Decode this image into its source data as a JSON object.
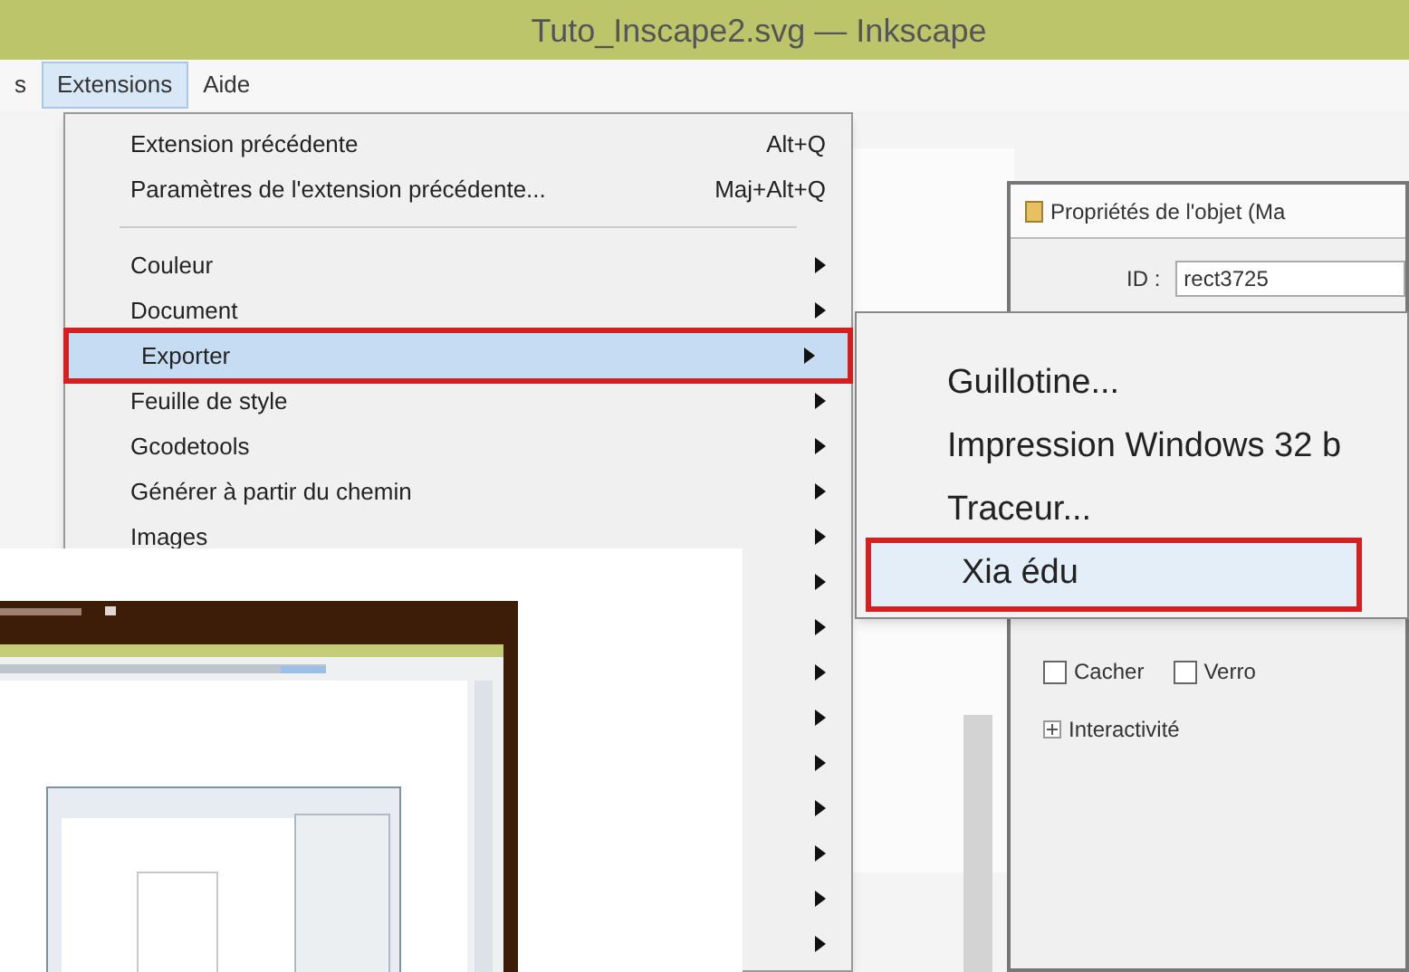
{
  "window": {
    "title": "Tuto_Inscape2.svg — Inkscape"
  },
  "menubar": [
    {
      "label": "s",
      "selected": false
    },
    {
      "label": "Extensions",
      "selected": true
    },
    {
      "label": "Aide",
      "selected": false
    }
  ],
  "menu": {
    "items": [
      {
        "kind": "item",
        "label": "Extension précédente",
        "shortcut": "Alt+Q",
        "has_submenu": false,
        "selected": false,
        "outlined": false
      },
      {
        "kind": "item",
        "label": "Paramètres de l'extension précédente...",
        "shortcut": "Maj+Alt+Q",
        "has_submenu": false,
        "selected": false,
        "outlined": false
      },
      {
        "kind": "separator"
      },
      {
        "kind": "item",
        "label": "Couleur",
        "has_submenu": true,
        "selected": false,
        "outlined": false
      },
      {
        "kind": "item",
        "label": "Document",
        "has_submenu": true,
        "selected": false,
        "outlined": false
      },
      {
        "kind": "item",
        "label": "Exporter",
        "has_submenu": true,
        "selected": true,
        "outlined": true
      },
      {
        "kind": "item",
        "label": "Feuille de style",
        "has_submenu": true,
        "selected": false,
        "outlined": false
      },
      {
        "kind": "item",
        "label": "Gcodetools",
        "has_submenu": true,
        "selected": false,
        "outlined": false
      },
      {
        "kind": "item",
        "label": "Générer à partir du chemin",
        "has_submenu": true,
        "selected": false,
        "outlined": false
      },
      {
        "kind": "item",
        "label": "Images",
        "has_submenu": true,
        "selected": false,
        "outlined": false
      },
      {
        "kind": "covered",
        "has_submenu": true
      },
      {
        "kind": "covered",
        "has_submenu": true
      },
      {
        "kind": "covered",
        "has_submenu": true
      },
      {
        "kind": "covered",
        "has_submenu": true
      },
      {
        "kind": "covered",
        "has_submenu": true
      },
      {
        "kind": "covered",
        "has_submenu": true
      },
      {
        "kind": "covered",
        "has_submenu": true
      },
      {
        "kind": "covered",
        "has_submenu": true
      },
      {
        "kind": "covered",
        "has_submenu": true
      }
    ]
  },
  "submenu": {
    "items": [
      {
        "label": "Guillotine...",
        "selected": false,
        "outlined": false
      },
      {
        "label": "Impression Windows 32 b",
        "selected": false,
        "outlined": false
      },
      {
        "label": "Traceur...",
        "selected": false,
        "outlined": false
      },
      {
        "label": "Xia édu",
        "selected": true,
        "outlined": true
      }
    ]
  },
  "properties_dialog": {
    "title": "Propriétés de l'objet (Ma",
    "id_label": "ID :",
    "id_value": "rect3725",
    "checkboxes": [
      {
        "label": "Cacher",
        "checked": false
      },
      {
        "label": "Verro",
        "checked": false
      }
    ],
    "expander": {
      "label": "Interactivité",
      "expanded": false
    }
  },
  "inset": {
    "kind": "screenshot"
  }
}
